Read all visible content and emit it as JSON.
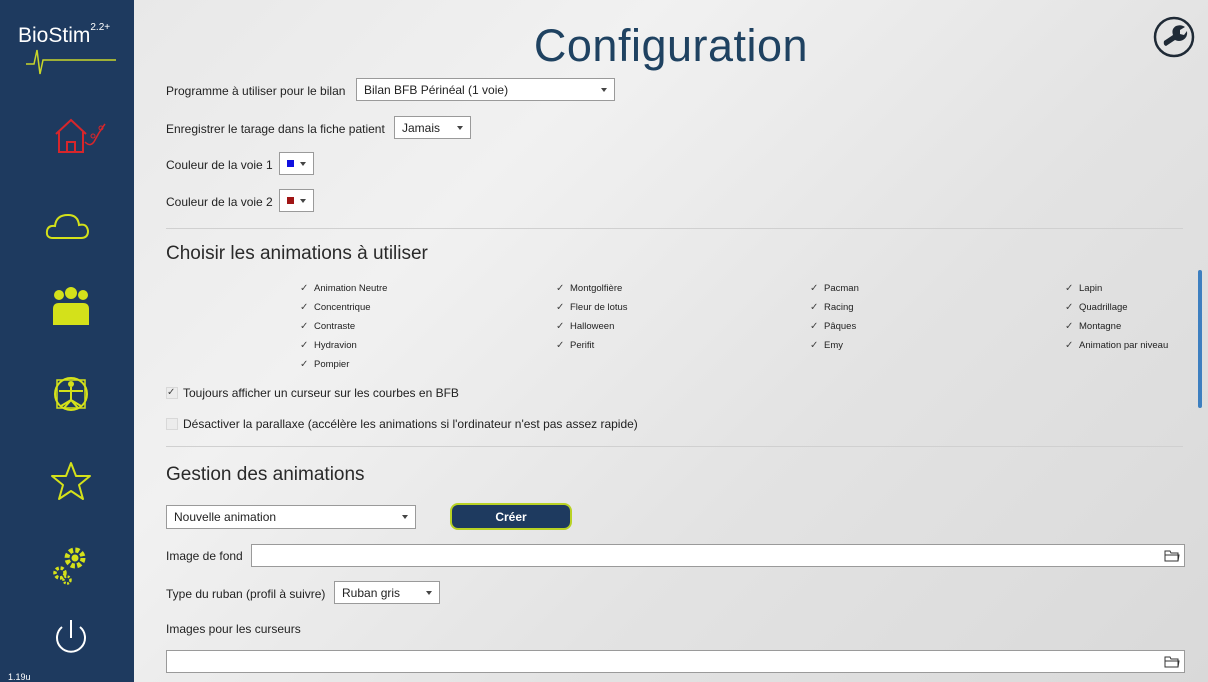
{
  "app": {
    "logo_text": "BioStim",
    "logo_version": "2.2+",
    "version": "1.19u"
  },
  "sidebar": {
    "items": [
      {
        "name": "home",
        "icon": "home-link-icon"
      },
      {
        "name": "cloud",
        "icon": "cloud-icon"
      },
      {
        "name": "patients",
        "icon": "group-icon"
      },
      {
        "name": "anatomy",
        "icon": "vitruvian-man-icon"
      },
      {
        "name": "favorites",
        "icon": "star-icon"
      },
      {
        "name": "settings",
        "icon": "gears-icon"
      },
      {
        "name": "power",
        "icon": "power-icon"
      }
    ]
  },
  "header": {
    "title": "Configuration",
    "icon": "wrench-icon"
  },
  "settings": {
    "program_label": "Programme à utiliser pour le bilan",
    "program_value": "Bilan BFB Périnéal (1 voie)",
    "tarage_label": "Enregistrer le tarage dans la fiche patient",
    "tarage_value": "Jamais",
    "channel1_label": "Couleur de la voie 1",
    "channel1_color": "#1010e0",
    "channel2_label": "Couleur de la voie 2",
    "channel2_color": "#a01515"
  },
  "animations": {
    "heading": "Choisir les animations à utiliser",
    "columns": [
      [
        {
          "label": "Animation Neutre",
          "checked": true
        },
        {
          "label": "Concentrique",
          "checked": true
        },
        {
          "label": "Contraste",
          "checked": true
        },
        {
          "label": "Hydravion",
          "checked": true
        },
        {
          "label": "Pompier",
          "checked": true
        }
      ],
      [
        {
          "label": "Montgolfière",
          "checked": true
        },
        {
          "label": "Fleur de lotus",
          "checked": true
        },
        {
          "label": "Halloween",
          "checked": true
        },
        {
          "label": "Perifit",
          "checked": true
        }
      ],
      [
        {
          "label": "Pacman",
          "checked": true
        },
        {
          "label": "Racing",
          "checked": true
        },
        {
          "label": "Pâques",
          "checked": true
        },
        {
          "label": "Emy",
          "checked": true
        }
      ],
      [
        {
          "label": "Lapin",
          "checked": true
        },
        {
          "label": "Quadrillage",
          "checked": true
        },
        {
          "label": "Montagne",
          "checked": true
        },
        {
          "label": "Animation par niveau",
          "checked": true
        }
      ]
    ],
    "cursor_option": {
      "label": "Toujours afficher un curseur sur les courbes en BFB",
      "checked": true
    },
    "parallax_option": {
      "label": "Désactiver la parallaxe (accélère les animations si l'ordinateur n'est pas assez rapide)",
      "checked": false
    }
  },
  "management": {
    "heading": "Gestion des animations",
    "new_animation_value": "Nouvelle animation",
    "create_button": "Créer",
    "background_label": "Image de fond",
    "background_value": "",
    "ribbon_label": "Type du ruban (profil à suivre)",
    "ribbon_value": "Ruban gris",
    "cursors_label": "Images pour les curseurs",
    "cursors_value": ""
  },
  "colors": {
    "sidebar": "#1e3a5f",
    "accent_red": "#d7262b",
    "accent_yellow": "#d4e11a",
    "title": "#1f4261"
  }
}
